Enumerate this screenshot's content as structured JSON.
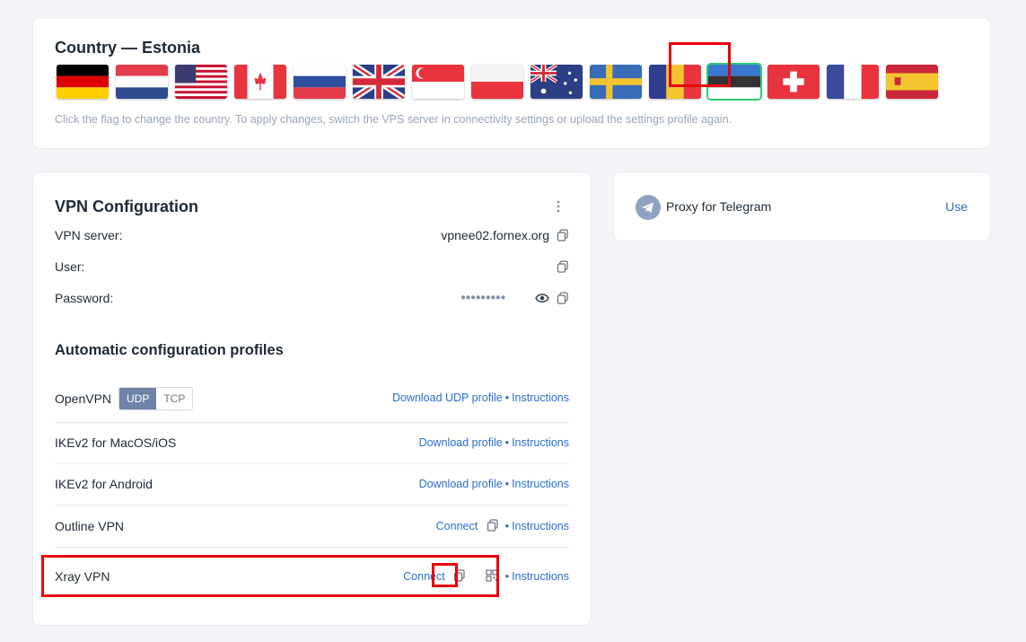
{
  "country": {
    "title": "Country — Estonia",
    "hint": "Click the flag to change the country. To apply changes, switch the VPS server in connectivity settings or upload the settings profile again.",
    "selected": "Estonia",
    "flags": [
      "Germany",
      "Netherlands",
      "USA",
      "Canada",
      "Russia",
      "United Kingdom",
      "Singapore",
      "Poland",
      "Australia",
      "Sweden",
      "Romania",
      "Estonia",
      "Switzerland",
      "France",
      "Spain"
    ]
  },
  "vpn": {
    "title": "VPN Configuration",
    "server_label": "VPN server:",
    "server_value": "vpnee02.fornex.org",
    "user_label": "User:",
    "password_label": "Password:",
    "password_mask": "●●●●●●●●●",
    "profiles_title": "Automatic configuration profiles",
    "openvpn": {
      "label": "OpenVPN",
      "udp": "UDP",
      "tcp": "TCP",
      "download": "Download UDP profile",
      "instructions": "Instructions"
    },
    "ikev2_mac": {
      "label": "IKEv2 for MacOS/iOS",
      "download": "Download profile",
      "instructions": "Instructions"
    },
    "ikev2_android": {
      "label": "IKEv2 for Android",
      "download": "Download profile",
      "instructions": "Instructions"
    },
    "outline": {
      "label": "Outline VPN",
      "connect": "Connect",
      "instructions": "Instructions"
    },
    "xray": {
      "label": "Xray VPN",
      "connect": "Connect",
      "instructions": "Instructions"
    },
    "separator": "•"
  },
  "telegram": {
    "label": "Proxy for Telegram",
    "use": "Use"
  },
  "colors": {
    "accent": "#2a6fd0",
    "highlight": "#e8000d",
    "selected_flag": "#2ecc71"
  }
}
